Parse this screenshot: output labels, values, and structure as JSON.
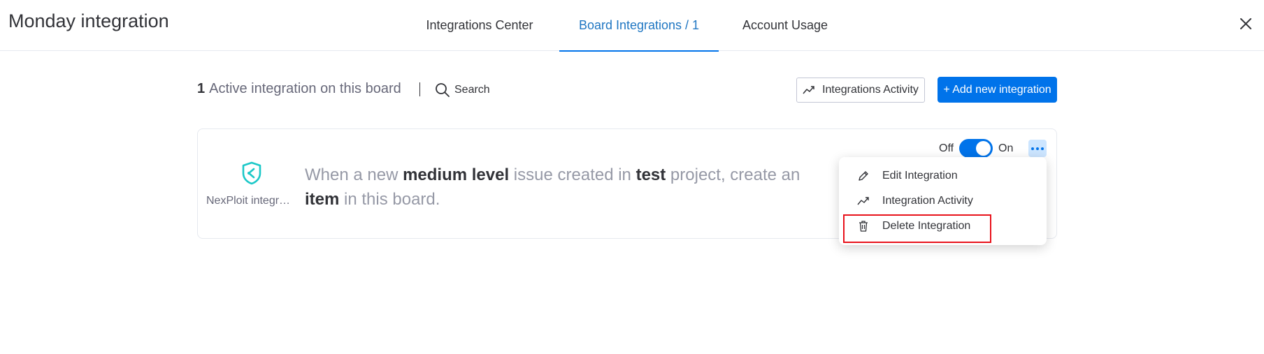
{
  "header": {
    "title": "Monday integration",
    "tabs": [
      {
        "label": "Integrations Center"
      },
      {
        "label": "Board Integrations / 1"
      },
      {
        "label": "Account Usage"
      }
    ],
    "close_icon": "close-icon"
  },
  "toolbar": {
    "count": "1",
    "summary_text": "Active integration on this board",
    "search_label": "Search",
    "activity_label": "Integrations Activity",
    "add_label": "+ Add new integration"
  },
  "integration": {
    "app_name": "NexPloit integration",
    "recipe": {
      "p1": "When a new ",
      "b1": "medium level",
      "p2": " issue created in ",
      "b2": "test",
      "p3": " project, create an ",
      "b3": "item",
      "p4": " in this board."
    },
    "toggle_off": "Off",
    "toggle_on": "On",
    "enabled": true
  },
  "menu": {
    "items": [
      {
        "label": "Edit Integration",
        "icon": "pencil-icon"
      },
      {
        "label": "Integration Activity",
        "icon": "trend-icon"
      },
      {
        "label": "Delete Integration",
        "icon": "trash-icon"
      }
    ]
  },
  "colors": {
    "accent": "#0073ea",
    "active_tab": "#1f76c2",
    "highlight": "#e8121b"
  }
}
